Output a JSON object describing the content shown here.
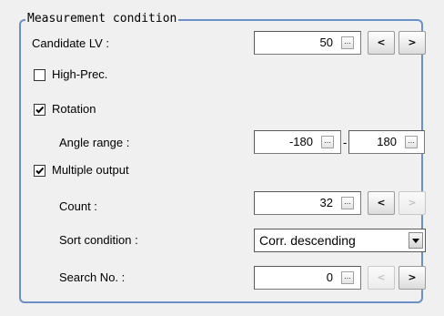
{
  "group": {
    "title": "Measurement condition"
  },
  "candidate_lv": {
    "label": "Candidate LV :",
    "value": "50",
    "dots": "...",
    "dec": "<",
    "inc": ">"
  },
  "high_prec": {
    "label": "High-Prec.",
    "checked": false
  },
  "rotation": {
    "label": "Rotation",
    "checked": true
  },
  "angle_range": {
    "label": "Angle range :",
    "min": "-180",
    "separator": "-",
    "max": "180",
    "dots": "..."
  },
  "multiple_output": {
    "label": "Multiple output",
    "checked": true
  },
  "count": {
    "label": "Count :",
    "value": "32",
    "dots": "...",
    "dec": "<",
    "inc": ">"
  },
  "sort_condition": {
    "label": "Sort condition :",
    "value": "Corr. descending"
  },
  "search_no": {
    "label": "Search No. :",
    "value": "0",
    "dots": "...",
    "dec": "<",
    "inc": ">"
  }
}
